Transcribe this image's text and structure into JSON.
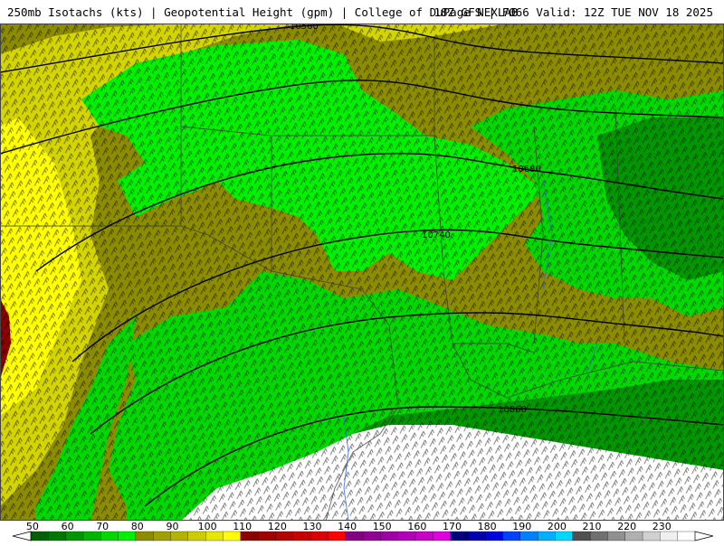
{
  "header": {
    "left": "250mb Isotachs (kts) | Geopotential Height (gpm) | College of DuPage NEXLAB",
    "right": "18Z GFS | F066 Valid: 12Z TUE NOV 18 2025"
  },
  "map": {
    "contours": [
      {
        "label": "10560"
      },
      {
        "label": "10680"
      },
      {
        "label": "10740"
      },
      {
        "label": "10860"
      }
    ]
  },
  "legend": {
    "tick_labels": [
      "50",
      "60",
      "70",
      "80",
      "90",
      "100",
      "110",
      "120",
      "130",
      "140",
      "150",
      "160",
      "170",
      "180",
      "190",
      "200",
      "210",
      "220",
      "230"
    ],
    "colors": [
      "#006000",
      "#007800",
      "#009600",
      "#00b400",
      "#00d800",
      "#00f000",
      "#8c8c00",
      "#a0a000",
      "#b4b400",
      "#cccc00",
      "#e6e600",
      "#ffff00",
      "#8c0000",
      "#a00000",
      "#b40000",
      "#c80000",
      "#dc0000",
      "#ff0000",
      "#800080",
      "#900090",
      "#a000a0",
      "#b400b4",
      "#c800c8",
      "#e000e0",
      "#000080",
      "#0000b0",
      "#0000e0",
      "#0040ff",
      "#0080ff",
      "#00b0ff",
      "#00d8ff",
      "#505050",
      "#707070",
      "#909090",
      "#b0b0b0",
      "#d0d0d0",
      "#f0f0f0",
      "#ffffff"
    ]
  }
}
